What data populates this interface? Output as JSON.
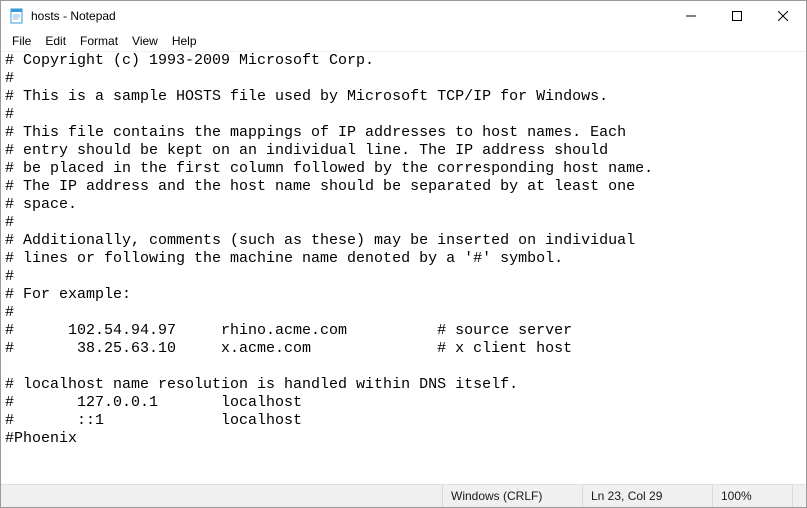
{
  "window": {
    "title": "hosts - Notepad"
  },
  "menu": {
    "file": "File",
    "edit": "Edit",
    "format": "Format",
    "view": "View",
    "help": "Help"
  },
  "document": {
    "text": "# Copyright (c) 1993-2009 Microsoft Corp.\n#\n# This is a sample HOSTS file used by Microsoft TCP/IP for Windows.\n#\n# This file contains the mappings of IP addresses to host names. Each\n# entry should be kept on an individual line. The IP address should\n# be placed in the first column followed by the corresponding host name.\n# The IP address and the host name should be separated by at least one\n# space.\n#\n# Additionally, comments (such as these) may be inserted on individual\n# lines or following the machine name denoted by a '#' symbol.\n#\n# For example:\n#\n#      102.54.94.97     rhino.acme.com          # source server\n#       38.25.63.10     x.acme.com              # x client host\n\n# localhost name resolution is handled within DNS itself.\n#       127.0.0.1       localhost\n#       ::1             localhost\n#Phoenix"
  },
  "status": {
    "line_ending": "Windows (CRLF)",
    "linecol": "Ln 23, Col 29",
    "zoom": "100%"
  }
}
